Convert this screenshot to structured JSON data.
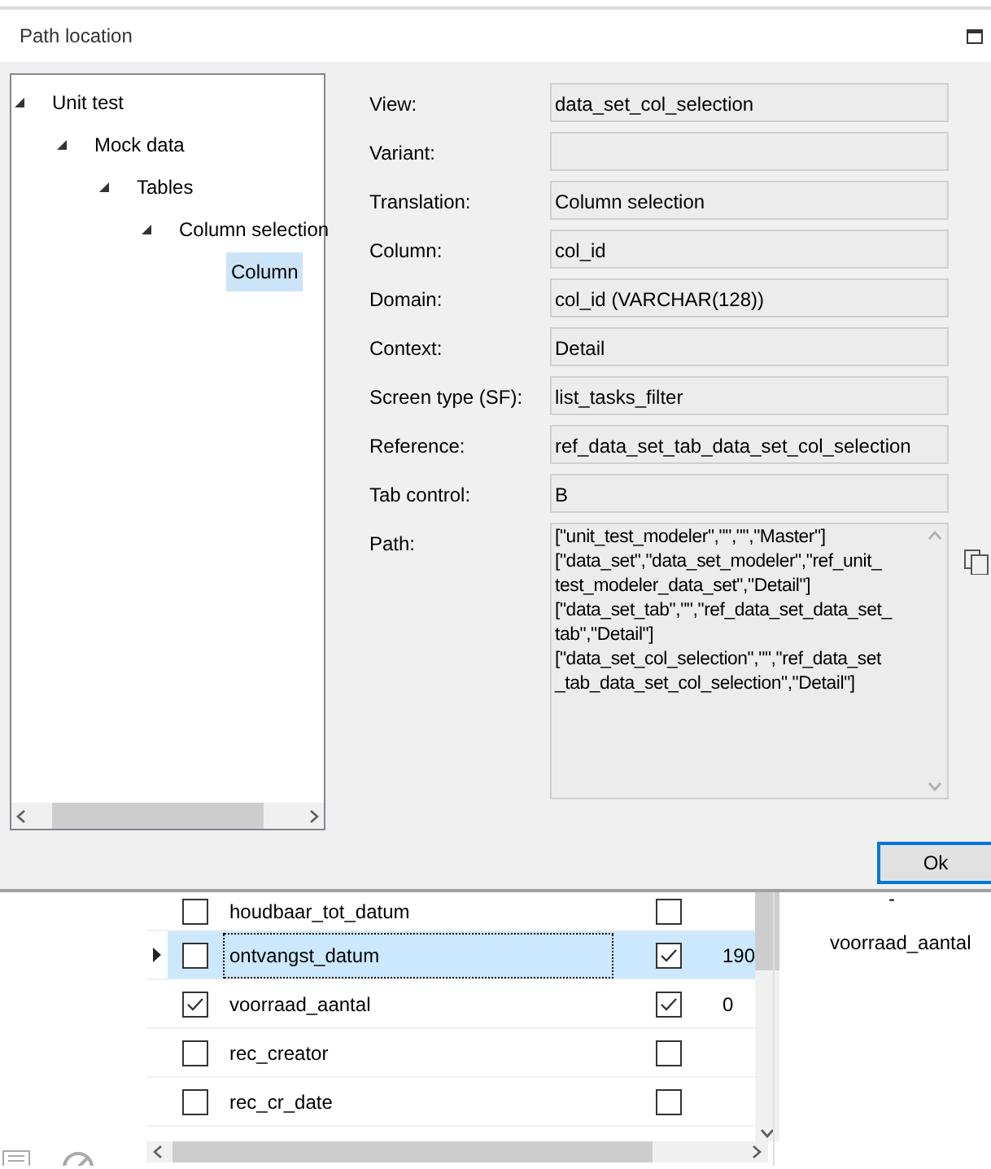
{
  "window": {
    "title": "Path location"
  },
  "tree": [
    {
      "label": "Unit test",
      "expanded": true,
      "selected": false,
      "children": [
        {
          "label": "Mock data",
          "expanded": true,
          "selected": false,
          "children": [
            {
              "label": "Tables",
              "expanded": true,
              "selected": false,
              "children": [
                {
                  "label": "Column selection",
                  "expanded": true,
                  "selected": false,
                  "children": [
                    {
                      "label": "Column",
                      "selected": true
                    }
                  ]
                }
              ]
            }
          ]
        }
      ]
    }
  ],
  "fields": [
    {
      "label": "View:",
      "value": "data_set_col_selection"
    },
    {
      "label": "Variant:"
    },
    {
      "label": "Translation:",
      "value": "Column selection"
    },
    {
      "label": "Column:",
      "value": "col_id"
    },
    {
      "label": "Domain:",
      "value": "col_id (VARCHAR(128))"
    },
    {
      "label": "Context:",
      "value": "Detail"
    },
    {
      "label": "Screen type (SF):",
      "value": "list_tasks_filter"
    },
    {
      "label": "Reference:",
      "value": "ref_data_set_tab_data_set_col_selection"
    },
    {
      "label": "Tab control:",
      "value": "B"
    }
  ],
  "path": {
    "label": "Path:",
    "lines": [
      "[\"unit_test_modeler\",\"\",\"\",\"Master\"]",
      "[\"data_set\",\"data_set_modeler\",\"ref_unit_",
      "test_modeler_data_set\",\"Detail\"]",
      "[\"data_set_tab\",\"\",\"ref_data_set_data_set_",
      "tab\",\"Detail\"]",
      "[\"data_set_col_selection\",\"\",\"ref_data_set",
      "_tab_data_set_col_selection\",\"Detail\"]"
    ]
  },
  "buttons": [
    {
      "label": "Ok"
    }
  ],
  "grid": {
    "rows": [
      {
        "selected": false,
        "check_1": false,
        "name": "houdbaar_tot_datum",
        "check_2": false
      },
      {
        "selected": true,
        "check_1": false,
        "name": "ontvangst_datum",
        "check_2": true,
        "value": "190"
      },
      {
        "selected": false,
        "check_1": true,
        "name": "voorraad_aantal",
        "check_2": true,
        "value": "0"
      },
      {
        "selected": false,
        "check_1": false,
        "name": "rec_creator",
        "check_2": false
      },
      {
        "selected": false,
        "check_1": false,
        "name": "rec_cr_date",
        "check_2": false
      }
    ]
  },
  "side_panel": {
    "fragment": "-",
    "text": "voorraad_aantal"
  }
}
